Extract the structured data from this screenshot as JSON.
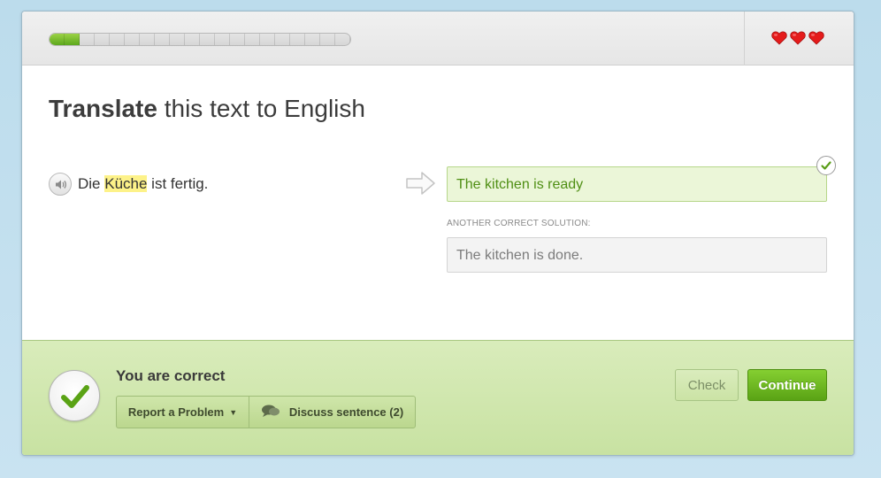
{
  "progress": {
    "filled_segments": 2,
    "total_segments": 20,
    "fraction": 0.1
  },
  "lives": {
    "hearts": 3
  },
  "question": {
    "title_bold": "Translate",
    "title_rest": " this text to English"
  },
  "sentence": {
    "before": "Die ",
    "highlighted": "Küche",
    "after": " ist fertig."
  },
  "answer": {
    "value": "The kitchen is ready"
  },
  "alternative": {
    "label": "ANOTHER CORRECT SOLUTION:",
    "value": "The kitchen is done."
  },
  "footer": {
    "verdict": "You are correct",
    "report_label": "Report a Problem",
    "discuss_label": "Discuss sentence (2)",
    "check_label": "Check",
    "continue_label": "Continue"
  },
  "colors": {
    "accent": "#5da81d",
    "heart": "#e51b1b",
    "correct_bg": "#c8e2a2"
  }
}
